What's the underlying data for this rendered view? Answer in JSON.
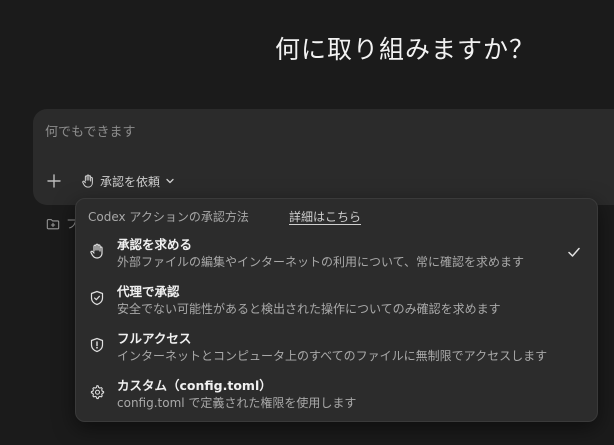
{
  "headline": "何に取り組みますか？",
  "composer": {
    "placeholder": "何でもできます",
    "add_icon": "plus-icon",
    "approval_button_label": "承認を依頼",
    "approval_icon": "hand-icon",
    "chevron_icon": "chevron-down-icon"
  },
  "below_row": {
    "icon": "folder-plus-icon",
    "partial_label": "フ"
  },
  "popup": {
    "header": "Codex アクションの承認方法",
    "details_link": "詳細はこちら",
    "options": [
      {
        "title": "承認を求める",
        "description": "外部ファイルの編集やインターネットの利用について、常に確認を求めます",
        "icon": "hand-icon",
        "selected": true
      },
      {
        "title": "代理で承認",
        "description": "安全でない可能性があると検出された操作についてのみ確認を求めます",
        "icon": "shield-check-icon",
        "selected": false
      },
      {
        "title": "フルアクセス",
        "description": "インターネットとコンピュータ上のすべてのファイルに無制限でアクセスします",
        "icon": "alert-circle-icon",
        "selected": false
      },
      {
        "title": "カスタム（config.toml）",
        "description": "config.toml で定義された権限を使用します",
        "icon": "gear-icon",
        "selected": false
      }
    ]
  },
  "colors": {
    "background": "#1b1b1b",
    "composer": "#2b2b2b",
    "popup": "#2c2c2c",
    "text": "#f0f0f0",
    "muted": "#a9a9a9"
  }
}
